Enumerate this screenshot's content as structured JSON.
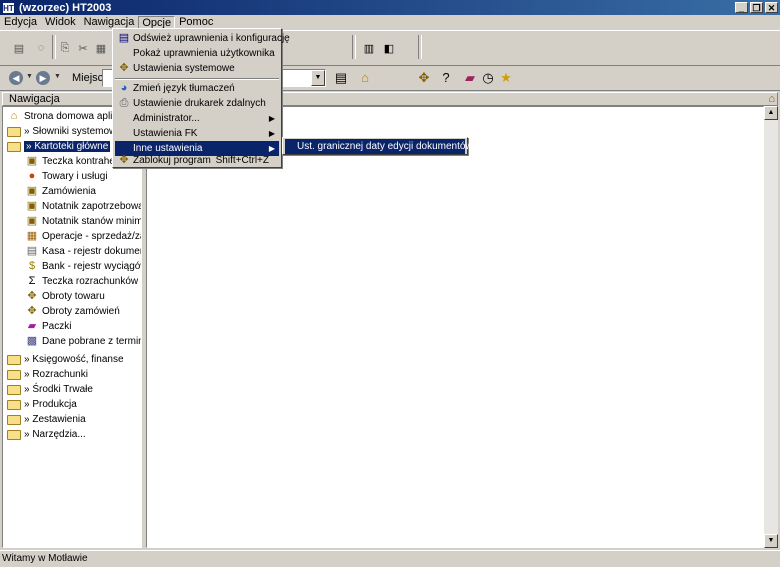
{
  "window": {
    "title": "(wzorzec) HT2003",
    "app_icon": "HT"
  },
  "menubar": [
    "Edycja",
    "Widok",
    "Nawigacja",
    "Opcje",
    "Pomoc"
  ],
  "toolbar2": {
    "location_label": "Miejsce"
  },
  "nav_header": "Nawigacja",
  "tree": [
    {
      "label": "Strona domowa aplikacji",
      "icon": "home-icon",
      "indent": 0
    },
    {
      "label": "» Słowniki systemowe",
      "icon": "folder-icon",
      "indent": 0
    },
    {
      "label": "» Kartoteki główne",
      "icon": "folder-open-icon",
      "indent": 0,
      "selected": true
    },
    {
      "label": "Teczka kontrahentów",
      "icon": "folder-contacts-icon",
      "indent": 1
    },
    {
      "label": "Towary i usługi",
      "icon": "goods-icon",
      "indent": 1
    },
    {
      "label": "Zamówienia",
      "icon": "orders-icon",
      "indent": 1
    },
    {
      "label": "Notatnik zapotrzebowań",
      "icon": "notebook-icon",
      "indent": 1
    },
    {
      "label": "Notatnik stanów minimal...",
      "icon": "notebook-icon",
      "indent": 1
    },
    {
      "label": "Operacje - sprzedaż/zak...",
      "icon": "operations-icon",
      "indent": 1
    },
    {
      "label": "Kasa - rejestr dokumentó...",
      "icon": "cash-register-icon",
      "indent": 1
    },
    {
      "label": "Bank - rejestr wyciągów ...",
      "icon": "bank-icon",
      "indent": 1
    },
    {
      "label": "Teczka rozrachunków",
      "icon": "sigma-icon",
      "indent": 1
    },
    {
      "label": "Obroty towaru",
      "icon": "turnover-icon",
      "indent": 1
    },
    {
      "label": "Obroty zamówień",
      "icon": "turnover-icon",
      "indent": 1
    },
    {
      "label": "Paczki",
      "icon": "package-icon",
      "indent": 1
    },
    {
      "label": "Dane pobrane z terminal...",
      "icon": "terminal-icon",
      "indent": 1
    },
    {
      "label": "» Księgowość, finanse",
      "icon": "folder-icon",
      "indent": 0
    },
    {
      "label": "» Rozrachunki",
      "icon": "folder-icon",
      "indent": 0
    },
    {
      "label": "» Środki Trwałe",
      "icon": "folder-icon",
      "indent": 0
    },
    {
      "label": "» Produkcja",
      "icon": "folder-icon",
      "indent": 0
    },
    {
      "label": "» Zestawienia",
      "icon": "folder-icon",
      "indent": 0
    },
    {
      "label": "» Narzędzia...",
      "icon": "folder-icon",
      "indent": 0
    }
  ],
  "opcje_menu": [
    {
      "label": "Odśwież uprawnienia i konfigurację",
      "icon": "refresh-permissions-icon"
    },
    {
      "label": "Pokaż uprawnienia użytkownika",
      "icon": ""
    },
    {
      "label": "Ustawienia systemowe",
      "icon": "system-settings-icon"
    },
    {
      "label": "Zmień język tłumaczeń",
      "icon": "language-icon"
    },
    {
      "label": "Ustawienie drukarek zdalnych",
      "icon": "printer-icon"
    },
    {
      "label": "Administrator...",
      "icon": "",
      "submenu": true
    },
    {
      "label": "Ustawienia FK",
      "icon": "",
      "submenu": true
    },
    {
      "label": "Inne ustawienia",
      "icon": "",
      "submenu": true,
      "highlighted": true
    },
    {
      "label": "Zablokuj program",
      "icon": "lock-program-icon",
      "shortcut": "Shift+Ctrl+Z"
    }
  ],
  "submenu": {
    "label": "Ust. granicznej daty edycji dokumentów"
  },
  "status": "Witamy w Motławie",
  "colors": {
    "selection": "#0a246a",
    "face": "#d4d0c8",
    "folder": "#f8e08a"
  }
}
